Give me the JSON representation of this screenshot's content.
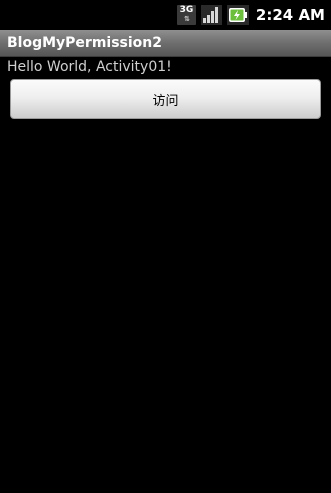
{
  "status_bar": {
    "network_label": "3G",
    "network_icon": "3g-data-icon",
    "signal_icon": "signal-strength-icon",
    "battery_icon": "battery-charging-icon",
    "time": "2:24",
    "time_suffix": "AM"
  },
  "app": {
    "title": "BlogMyPermission2"
  },
  "main": {
    "text": "Hello World, Activity01!",
    "button_label": "访问"
  },
  "colors": {
    "background": "#000000",
    "title_bar": "#6e6e6e",
    "text": "#cfcfcf",
    "battery_accent": "#6bbf3c"
  }
}
